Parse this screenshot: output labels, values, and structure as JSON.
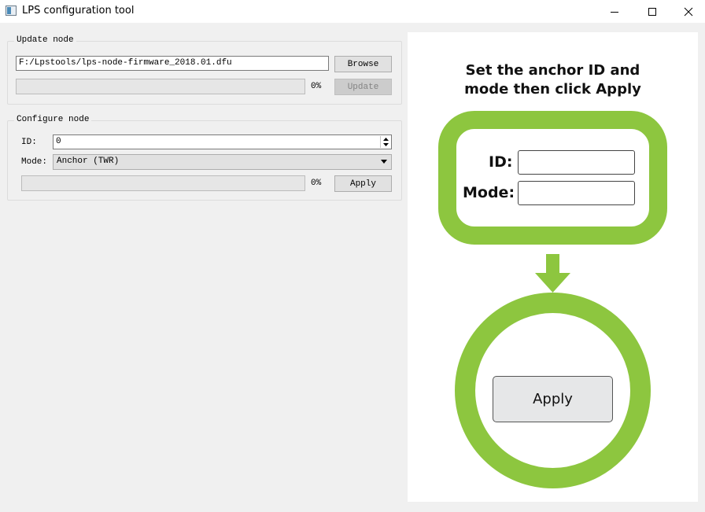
{
  "window": {
    "title": "LPS configuration tool"
  },
  "update_node": {
    "group_title": "Update node",
    "file_path": "F:/Lpstools/lps-node-firmware_2018.01.dfu",
    "browse_label": "Browse",
    "progress_percent": 0,
    "progress_text": "0%",
    "update_label": "Update",
    "update_enabled": false
  },
  "configure_node": {
    "group_title": "Configure node",
    "id_label": "ID:",
    "id_value": "0",
    "mode_label": "Mode:",
    "mode_value": "Anchor (TWR)",
    "progress_percent": 0,
    "progress_text": "0%",
    "apply_label": "Apply"
  },
  "instructions": {
    "heading_line1": "Set the anchor ID and",
    "heading_line2": "mode then click Apply",
    "id_label": "ID:",
    "mode_label": "Mode:",
    "apply_label": "Apply",
    "accent_color": "#8dc63f"
  }
}
